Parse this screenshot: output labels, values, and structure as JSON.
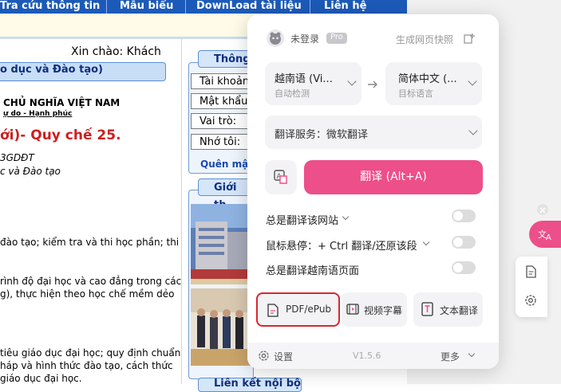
{
  "navbar": {
    "items": [
      "Tra cứu thông tin",
      "Mẫu biểu",
      "DownLoad tài liệu",
      "Liên hệ"
    ]
  },
  "greeting": "Xin chào: Khách",
  "left_header": "o dục và Đào tạo)",
  "document": {
    "line1": "CHỦ NGHĨA VIỆT NAM",
    "line2": "ự do - Hạnh phúc",
    "title": "ới)- Quy chế 25.",
    "ref1": "3GDĐT",
    "ref2": "c và Đào tạo",
    "p1": "đào tạo; kiểm tra và thi học phần; thi",
    "p2a": "rình độ đại học và cao đẳng trong các",
    "p2b": "g), thực hiện theo học chế mềm dẻo",
    "p3a": "tiêu giáo dục đại học; quy định chuẩn",
    "p3b": "háp và hình thức đào tạo, cách thức",
    "p3c": "giáo dục đại học."
  },
  "login": {
    "tab": "Thông",
    "account": "Tài khoản",
    "password": "Mật khẩu",
    "role": "Vai trò:",
    "remember": "Nhớ tôi:",
    "forgot": "Quên mậ"
  },
  "intro_tab": "Giới th",
  "contact_tab": "Liên kết nội bộ",
  "popup": {
    "user": "未登录",
    "pro_badge": "Pro",
    "snapshot": "生成网页快照",
    "source_lang": "越南语 (Vi...",
    "source_sub": "自动检测",
    "target_lang": "简体中文 (...",
    "target_sub": "目标语言",
    "service": "翻译服务：微软翻译",
    "translate_button": "翻译 (Alt+A)",
    "option1": "总是翻译该网站",
    "option2": "鼠标悬停：+ Ctrl 翻译/还原该段",
    "option3": "总是翻译越南语页面",
    "tools": [
      "PDF/ePub",
      "视频字幕",
      "文本翻译"
    ],
    "settings": "设置",
    "version": "V1.5.6",
    "more": "更多"
  },
  "colors": {
    "accent": "#ec4f89",
    "nav_blue": "#1c5ab9",
    "highlight_border": "#d7282f",
    "doc_red": "#cc1f1f"
  }
}
